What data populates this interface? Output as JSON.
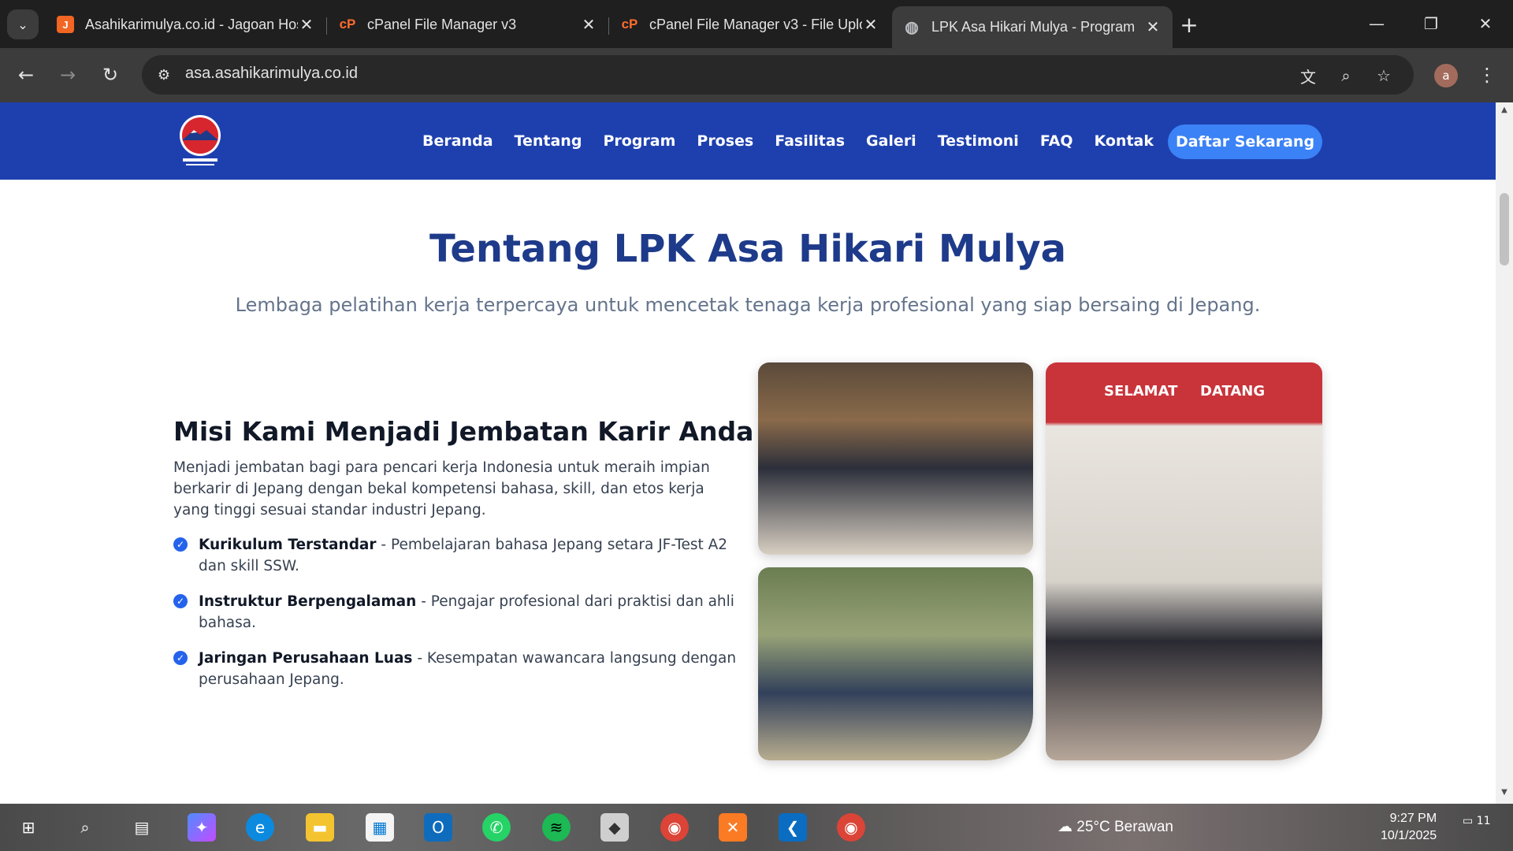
{
  "browser": {
    "tabs": [
      {
        "title": "Asahikarimulya.co.id - Jagoan Hosting",
        "favicon": "jagoan-hosting-icon"
      },
      {
        "title": "cPanel File Manager v3",
        "favicon": "cpanel-icon"
      },
      {
        "title": "cPanel File Manager v3 - File Upload",
        "favicon": "cpanel-icon"
      },
      {
        "title": "LPK Asa Hikari Mulya - Program",
        "favicon": "globe-icon"
      }
    ],
    "url": "asa.asahikarimulya.co.id",
    "profile_initial": "a"
  },
  "site": {
    "nav": [
      "Beranda",
      "Tentang",
      "Program",
      "Proses",
      "Fasilitas",
      "Galeri",
      "Testimoni",
      "FAQ",
      "Kontak"
    ],
    "cta": "Daftar Sekarang"
  },
  "about": {
    "title": "Tentang LPK Asa Hikari Mulya",
    "subtitle": "Lembaga pelatihan kerja terpercaya untuk mencetak tenaga kerja profesional yang siap bersaing di Jepang.",
    "mission_title": "Misi Kami Menjadi Jembatan Karir Anda",
    "mission_text": "Menjadi jembatan bagi para pencari kerja Indonesia untuk meraih impian berkarir di Jepang dengan bekal kompetensi bahasa, skill, dan etos kerja yang tinggi sesuai standar industri Jepang.",
    "points": [
      {
        "bold": "Kurikulum Terstandar",
        "text": " - Pembelajaran bahasa Jepang setara JF-Test A2 dan skill SSW."
      },
      {
        "bold": "Instruktur Berpengalaman",
        "text": " - Pengajar profesional dari praktisi dan ahli bahasa."
      },
      {
        "bold": "Jaringan Perusahaan Luas",
        "text": " - Kesempatan wawancara langsung dengan perusahaan Jepang."
      }
    ],
    "sign_left": "SELAMAT",
    "sign_right": "DATANG"
  },
  "taskbar": {
    "weather": "25°C  Berawan",
    "time": "9:27 PM",
    "date": "10/1/2025",
    "notifications": "11"
  }
}
